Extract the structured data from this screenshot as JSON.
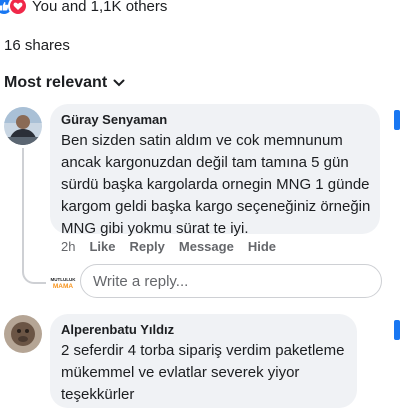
{
  "reactions": {
    "summary": "You and 1,1K others",
    "icons": [
      "like-icon",
      "love-icon"
    ],
    "colors": {
      "like": "#1877f2",
      "love": "#f02849"
    }
  },
  "shares": {
    "text": "16 shares"
  },
  "filter": {
    "label": "Most relevant",
    "icon": "chevron-down-icon"
  },
  "comments": [
    {
      "author": "Güray Senyaman",
      "lines": [
        "Ben sizden satin aldım ve cok memnunum",
        "ancak kargonuzdan değil tam tamına 5 gün",
        "sürdü başka kargolarda ornegin MNG 1 günde",
        "kargom geldi başka kargo seçeneğiniz örneğin",
        "MNG gibi yokmu sürat te iyi."
      ],
      "time": "2h",
      "actions": [
        "Like",
        "Reply",
        "Message",
        "Hide"
      ]
    },
    {
      "author": "Alperenbatu Yıldız",
      "lines": [
        "2 seferdir 4 torba sipariş verdim paketleme",
        "mükemmel ve evlatlar severek yiyor",
        "teşekkürler"
      ]
    }
  ],
  "reply": {
    "placeholder": "Write a reply...",
    "page_logo_text": [
      "MUTLULUK",
      "MAMA"
    ]
  }
}
